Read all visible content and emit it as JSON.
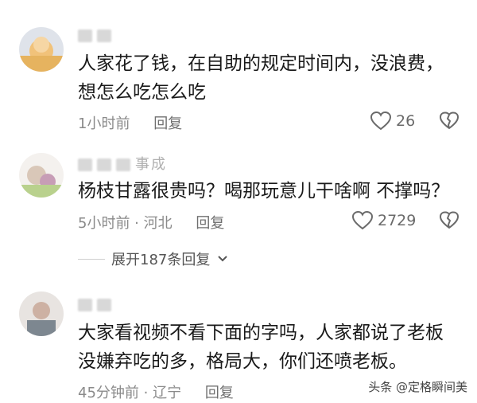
{
  "comments": [
    {
      "content": "人家花了钱，在自助的规定时间内，没浪费，想怎么吃怎么吃",
      "meta_time": "1小时前",
      "reply": "回复",
      "likes": "26"
    },
    {
      "author_suffix": "事成",
      "content": "杨枝甘露很贵吗？喝那玩意儿干啥啊 不撑吗？",
      "meta_time": "5小时前 · 河北",
      "reply": "回复",
      "likes": "2729",
      "expand_label": "展开187条回复"
    },
    {
      "content": "大家看视频不看下面的字吗，人家都说了老板没嫌弃吃的多，格局大，你们还喷老板。",
      "meta_time": "45分钟前 · 辽宁",
      "reply": "回复"
    }
  ],
  "watermark": {
    "text": "头条 @定格瞬间美"
  },
  "colors": {
    "icon": "#6a6a6a",
    "meta": "#8a8a8a",
    "text": "#1a1a1a"
  }
}
